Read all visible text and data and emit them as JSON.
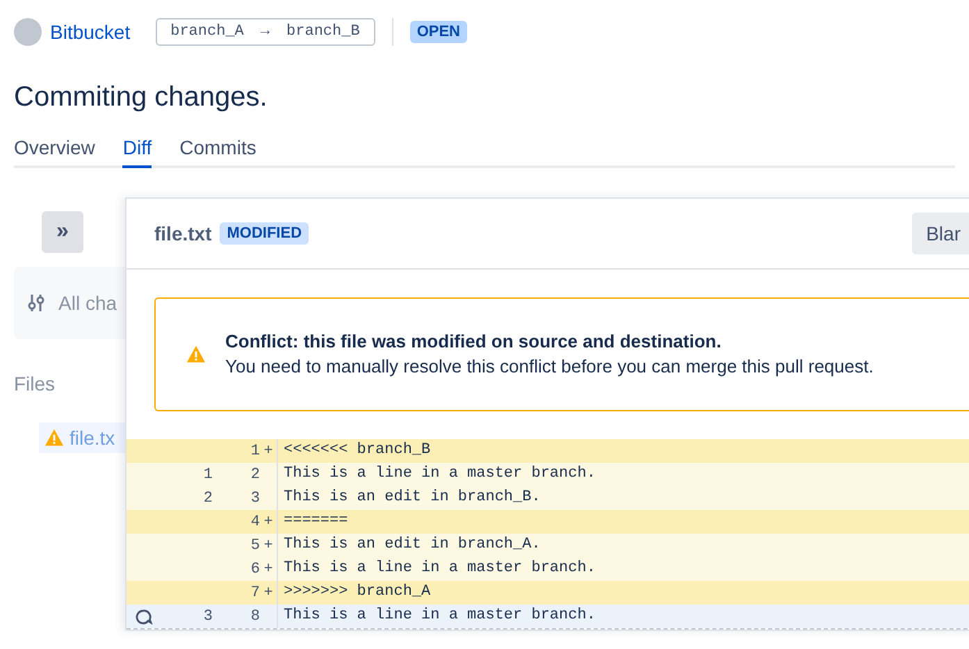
{
  "header": {
    "repository": "Bitbucket",
    "source_branch": "branch_A",
    "arrow": "→",
    "target_branch": "branch_B",
    "status": "OPEN"
  },
  "title": "Commiting changes.",
  "tabs": [
    {
      "label": "Overview",
      "selected": false
    },
    {
      "label": "Diff",
      "selected": true
    },
    {
      "label": "Commits",
      "selected": false
    }
  ],
  "sidebar": {
    "expand_button": "»",
    "filter": "All cha",
    "files_heading": "Files",
    "files": [
      {
        "name": "file.tx",
        "conflict": true
      }
    ]
  },
  "file": {
    "name": "file.txt",
    "badge": "MODIFIED",
    "blame_button": "Blar",
    "alert": {
      "title": "Conflict: this file was modified on source and destination.",
      "message": "You need to manually resolve this conflict before you can merge this pull request."
    },
    "lines": [
      {
        "kind": "marker",
        "new": "1",
        "sign": "+",
        "text": "<<<<<<< branch_B",
        "hovered": false
      },
      {
        "kind": "conflict",
        "old": "1",
        "new": "2",
        "text": "This is a line in a master branch.",
        "hovered": false
      },
      {
        "kind": "conflict",
        "old": "2",
        "new": "3",
        "text": "This is an edit in branch_B.",
        "hovered": false
      },
      {
        "kind": "marker",
        "new": "4",
        "sign": "+",
        "text": "=======",
        "hovered": false
      },
      {
        "kind": "conflict",
        "new": "5",
        "sign": "+",
        "text": "This is an edit in branch_A.",
        "hovered": false
      },
      {
        "kind": "conflict",
        "new": "6",
        "sign": "+",
        "text": "This is a line in a master branch.",
        "hovered": false
      },
      {
        "kind": "marker",
        "new": "7",
        "sign": "+",
        "text": ">>>>>>> branch_A",
        "hovered": false
      },
      {
        "kind": "plain",
        "old": "3",
        "new": "8",
        "text": "This is a line in a master branch.",
        "hovered": true
      }
    ]
  }
}
